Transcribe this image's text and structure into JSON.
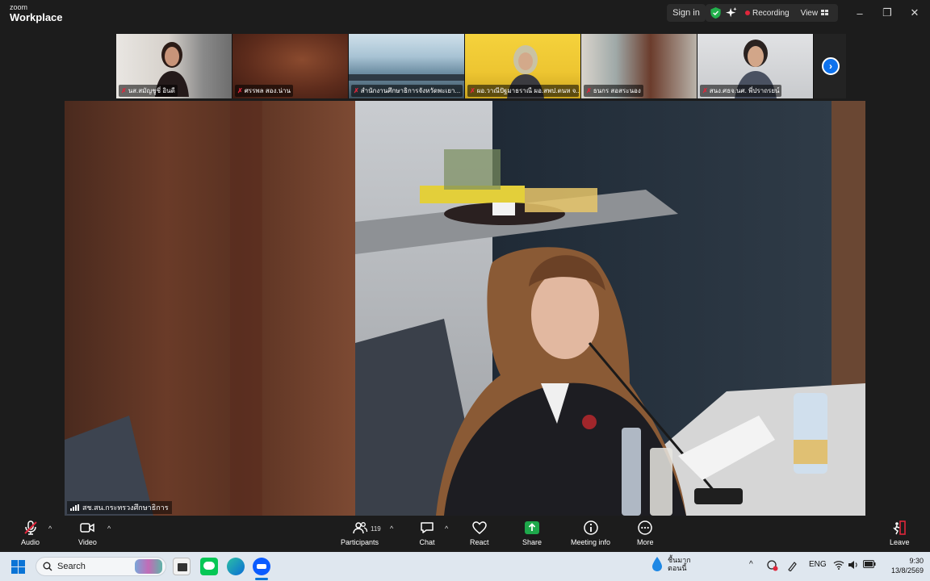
{
  "titlebar": {
    "brand_small": "zoom",
    "brand_big": "Workplace",
    "signin": "Sign in",
    "recording": "Recording",
    "view": "View",
    "min": "–",
    "restore": "❐",
    "close": "✕"
  },
  "participants": [
    {
      "name": "นส.สมัญชูชี่ อินดี",
      "bg": "#d9d6d1"
    },
    {
      "name": "ศรรพล สอง.น่าน",
      "bg": "#6b2e1e"
    },
    {
      "name": "สำนักงานศึกษาธิการจังหวัดพะเยา...",
      "bg": "#9db7c9"
    },
    {
      "name": "ผอ.วาณีปัฐมาธราณี ผอ.สพป.ตนห จ...",
      "bg": "#e8c53a"
    },
    {
      "name": "ธนกร สอสระนอง",
      "bg": "#7a8b8a"
    },
    {
      "name": "สนง.ศธจ.นศ. พี่ปราถรยน์",
      "bg": "#c7c9cc"
    }
  ],
  "strip_next": "›",
  "main": {
    "speaker_name": "สช.สน.กระทรวงศึกษาธิการ"
  },
  "toolbar": {
    "audio": "Audio",
    "video": "Video",
    "participants": "Participants",
    "participant_count": "119",
    "chat": "Chat",
    "react": "React",
    "share": "Share",
    "meeting_info": "Meeting info",
    "more": "More",
    "leave": "Leave",
    "caret": "^"
  },
  "taskbar": {
    "search_placeholder": "Search",
    "weather_line1": "ชื้นมาก",
    "weather_line2": "ตอนนี้",
    "lang": "ENG",
    "time": "9:30",
    "date": "13/8/2569"
  },
  "colors": {
    "accent_blue": "#0e72ed",
    "record_red": "#e0263b",
    "share_green": "#1ea84b",
    "leave_red": "#e0263b"
  }
}
